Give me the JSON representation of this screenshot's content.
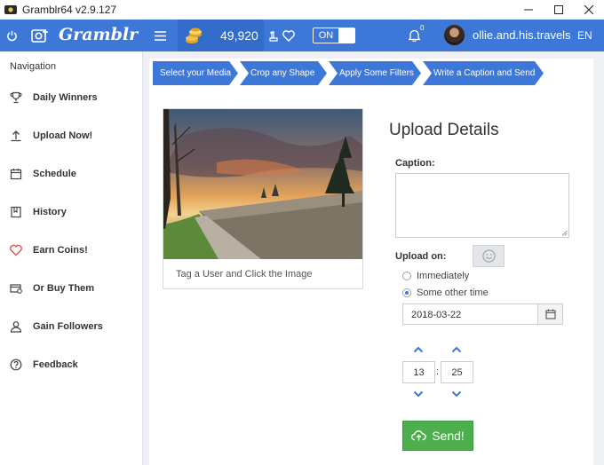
{
  "window": {
    "title": "Gramblr64 v2.9.127"
  },
  "header": {
    "brand": "Gramblr",
    "coins": "49,920",
    "toggle_label": "ON",
    "notification_count": "0",
    "username": "ollie.and.his.travels",
    "language": "EN"
  },
  "sidebar": {
    "heading": "Navigation",
    "items": [
      {
        "label": "Daily Winners",
        "icon": "trophy-icon"
      },
      {
        "label": "Upload Now!",
        "icon": "upload-icon"
      },
      {
        "label": "Schedule",
        "icon": "calendar-icon"
      },
      {
        "label": "History",
        "icon": "history-icon"
      },
      {
        "label": "Earn Coins!",
        "icon": "heart-icon"
      },
      {
        "label": "Or Buy Them",
        "icon": "card-icon"
      },
      {
        "label": "Gain Followers",
        "icon": "user-icon"
      },
      {
        "label": "Feedback",
        "icon": "help-icon"
      }
    ]
  },
  "steps": [
    "Select your Media",
    "Crop any Shape",
    "Apply Some Filters",
    "Write a Caption and Send"
  ],
  "image_card": {
    "tag_text": "Tag a User and Click the Image"
  },
  "upload": {
    "title": "Upload Details",
    "caption_label": "Caption:",
    "caption_value": "",
    "upload_on_label": "Upload on:",
    "options": [
      {
        "label": "Immediately",
        "checked": false
      },
      {
        "label": "Some other time",
        "checked": true
      }
    ],
    "date": "2018-03-22",
    "hour": "13",
    "minute": "25",
    "time_separator": ":",
    "send_label": "Send!"
  },
  "colors": {
    "accent": "#3d78d8",
    "send_green": "#4cae4c"
  }
}
